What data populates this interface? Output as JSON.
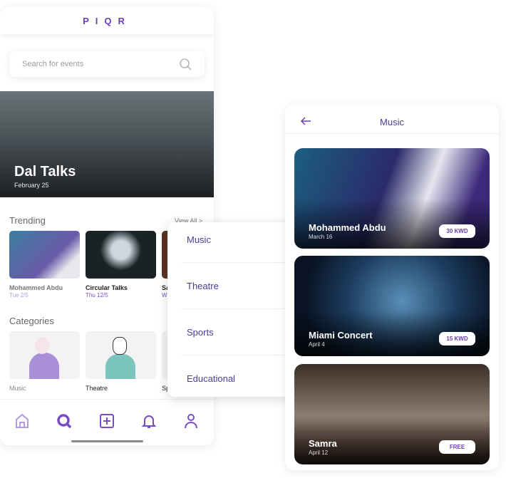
{
  "left": {
    "logo": "PIQR",
    "search_placeholder": "Search for events",
    "hero": {
      "title": "Dal Talks",
      "date": "February 25"
    },
    "trending": {
      "title": "Trending",
      "view_all": "View All >",
      "items": [
        {
          "name": "Mohammed Abdu",
          "date": "Tue 2/5"
        },
        {
          "name": "Circular Talks",
          "date": "Thu 12/5"
        },
        {
          "name": "Sa",
          "date": "W"
        }
      ]
    },
    "categories": {
      "title": "Categories",
      "items": [
        {
          "label": "Music"
        },
        {
          "label": "Theatre"
        },
        {
          "label": "Sp"
        }
      ]
    },
    "tabs": [
      "home-icon",
      "search-icon",
      "add-icon",
      "bell-icon",
      "user-icon"
    ]
  },
  "dropdown": {
    "items": [
      "Music",
      "Theatre",
      "Sports",
      "Educational"
    ]
  },
  "right": {
    "title": "Music",
    "events": [
      {
        "title": "Mohammed Abdu",
        "date": "March 16",
        "price": "30 KWD"
      },
      {
        "title": "Miami Concert",
        "date": "April 4",
        "price": "15 KWD"
      },
      {
        "title": "Samra",
        "date": "April 12",
        "price": "FREE"
      }
    ]
  },
  "colors": {
    "accent": "#6a3fb3",
    "dropdown_text": "#4a3d99"
  }
}
